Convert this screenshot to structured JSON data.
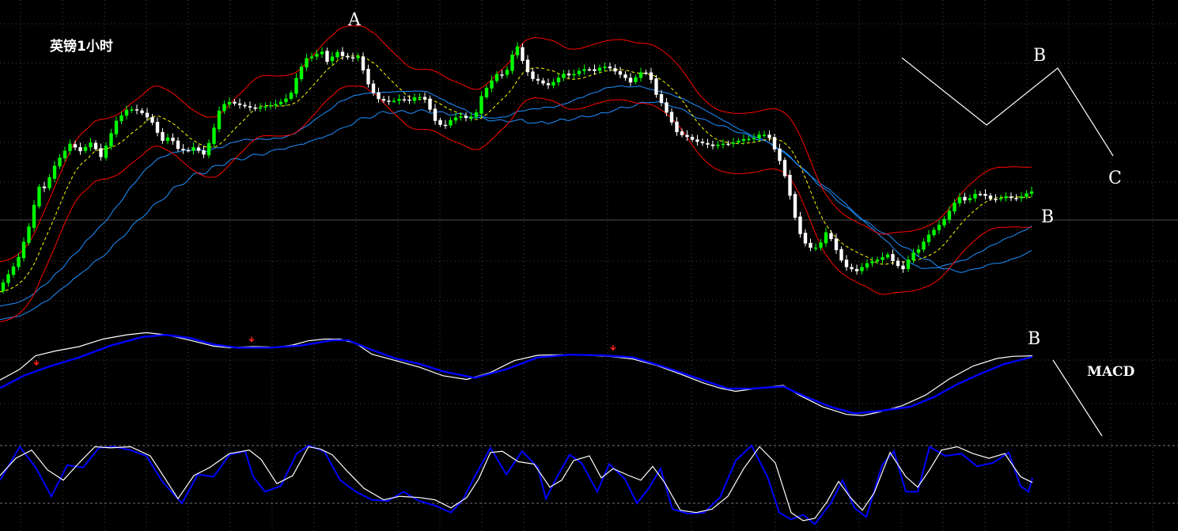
{
  "chart_data": {
    "type": "candlestick",
    "title": "英镑1小时",
    "indicator_label": "MACD",
    "wave_labels": {
      "price_top": "A",
      "diagram_b": "B",
      "diagram_c": "C",
      "price_right": "B",
      "macd_right": "B"
    },
    "colors": {
      "up": "#00ff00",
      "down": "#ffffff",
      "band": "#ff0000",
      "ma": "#1e90ff",
      "mid": "#ffff00",
      "macd_fast": "#ffffff",
      "macd_slow": "#0000ff",
      "kdj_fast": "#ffffff",
      "kdj_slow": "#0000ff",
      "marker": "#ff2020",
      "grid": "#5a5a5a"
    },
    "grid": true,
    "price_path": [
      [
        0,
        0.02
      ],
      [
        18,
        0.11
      ],
      [
        25,
        0.14
      ],
      [
        40,
        0.28
      ],
      [
        52,
        0.44
      ],
      [
        62,
        0.43
      ],
      [
        68,
        0.5
      ],
      [
        78,
        0.55
      ],
      [
        92,
        0.61
      ],
      [
        105,
        0.58
      ],
      [
        120,
        0.62
      ],
      [
        130,
        0.55
      ],
      [
        140,
        0.62
      ],
      [
        150,
        0.7
      ],
      [
        165,
        0.75
      ],
      [
        180,
        0.74
      ],
      [
        195,
        0.7
      ],
      [
        208,
        0.62
      ],
      [
        218,
        0.64
      ],
      [
        228,
        0.59
      ],
      [
        240,
        0.58
      ],
      [
        250,
        0.6
      ],
      [
        260,
        0.56
      ],
      [
        270,
        0.63
      ],
      [
        280,
        0.74
      ],
      [
        290,
        0.78
      ],
      [
        300,
        0.77
      ],
      [
        312,
        0.76
      ],
      [
        325,
        0.75
      ],
      [
        340,
        0.76
      ],
      [
        355,
        0.77
      ],
      [
        370,
        0.8
      ],
      [
        380,
        0.89
      ],
      [
        390,
        0.95
      ],
      [
        400,
        0.96
      ],
      [
        410,
        0.98
      ],
      [
        418,
        0.93
      ],
      [
        428,
        0.98
      ],
      [
        436,
        0.96
      ],
      [
        448,
        0.95
      ],
      [
        458,
        0.96
      ],
      [
        465,
        0.87
      ],
      [
        472,
        0.83
      ],
      [
        480,
        0.79
      ],
      [
        490,
        0.78
      ],
      [
        500,
        0.78
      ],
      [
        510,
        0.79
      ],
      [
        520,
        0.78
      ],
      [
        530,
        0.8
      ],
      [
        540,
        0.79
      ],
      [
        548,
        0.74
      ],
      [
        555,
        0.69
      ],
      [
        565,
        0.68
      ],
      [
        575,
        0.71
      ],
      [
        585,
        0.72
      ],
      [
        595,
        0.71
      ],
      [
        605,
        0.73
      ],
      [
        612,
        0.8
      ],
      [
        622,
        0.85
      ],
      [
        632,
        0.89
      ],
      [
        642,
        0.88
      ],
      [
        650,
        0.96
      ],
      [
        658,
        1.0
      ],
      [
        666,
        0.92
      ],
      [
        675,
        0.87
      ],
      [
        685,
        0.86
      ],
      [
        695,
        0.84
      ],
      [
        705,
        0.86
      ],
      [
        715,
        0.89
      ],
      [
        725,
        0.88
      ],
      [
        735,
        0.9
      ],
      [
        745,
        0.91
      ],
      [
        755,
        0.9
      ],
      [
        765,
        0.92
      ],
      [
        775,
        0.91
      ],
      [
        785,
        0.89
      ],
      [
        795,
        0.87
      ],
      [
        802,
        0.85
      ],
      [
        810,
        0.89
      ],
      [
        818,
        0.9
      ],
      [
        826,
        0.87
      ],
      [
        832,
        0.81
      ],
      [
        840,
        0.77
      ],
      [
        850,
        0.71
      ],
      [
        860,
        0.65
      ],
      [
        870,
        0.64
      ],
      [
        882,
        0.62
      ],
      [
        894,
        0.61
      ],
      [
        905,
        0.6
      ],
      [
        915,
        0.61
      ],
      [
        925,
        0.61
      ],
      [
        935,
        0.62
      ],
      [
        945,
        0.63
      ],
      [
        955,
        0.63
      ],
      [
        965,
        0.65
      ],
      [
        975,
        0.64
      ],
      [
        985,
        0.57
      ],
      [
        992,
        0.52
      ],
      [
        1000,
        0.43
      ],
      [
        1008,
        0.32
      ],
      [
        1016,
        0.24
      ],
      [
        1024,
        0.2
      ],
      [
        1032,
        0.19
      ],
      [
        1040,
        0.21
      ],
      [
        1048,
        0.26
      ],
      [
        1056,
        0.22
      ],
      [
        1064,
        0.16
      ],
      [
        1072,
        0.12
      ],
      [
        1080,
        0.11
      ],
      [
        1088,
        0.1
      ],
      [
        1096,
        0.13
      ],
      [
        1105,
        0.14
      ],
      [
        1115,
        0.15
      ],
      [
        1125,
        0.17
      ],
      [
        1135,
        0.13
      ],
      [
        1145,
        0.11
      ],
      [
        1155,
        0.17
      ],
      [
        1165,
        0.19
      ],
      [
        1175,
        0.24
      ],
      [
        1185,
        0.27
      ],
      [
        1195,
        0.3
      ],
      [
        1205,
        0.35
      ],
      [
        1215,
        0.4
      ],
      [
        1225,
        0.38
      ],
      [
        1235,
        0.41
      ],
      [
        1245,
        0.41
      ],
      [
        1255,
        0.39
      ],
      [
        1265,
        0.39
      ],
      [
        1275,
        0.4
      ],
      [
        1285,
        0.39
      ],
      [
        1295,
        0.4
      ],
      [
        1305,
        0.42
      ]
    ],
    "macd_white": [
      [
        0,
        0.1
      ],
      [
        25,
        0.3
      ],
      [
        45,
        0.55
      ],
      [
        70,
        0.64
      ],
      [
        100,
        0.72
      ],
      [
        130,
        0.86
      ],
      [
        160,
        0.94
      ],
      [
        185,
        0.98
      ],
      [
        210,
        0.94
      ],
      [
        240,
        0.84
      ],
      [
        270,
        0.73
      ],
      [
        290,
        0.7
      ],
      [
        320,
        0.72
      ],
      [
        350,
        0.71
      ],
      [
        370,
        0.75
      ],
      [
        390,
        0.83
      ],
      [
        410,
        0.86
      ],
      [
        430,
        0.86
      ],
      [
        450,
        0.78
      ],
      [
        470,
        0.58
      ],
      [
        500,
        0.46
      ],
      [
        530,
        0.34
      ],
      [
        560,
        0.18
      ],
      [
        590,
        0.11
      ],
      [
        620,
        0.24
      ],
      [
        650,
        0.46
      ],
      [
        680,
        0.56
      ],
      [
        710,
        0.57
      ],
      [
        740,
        0.56
      ],
      [
        770,
        0.54
      ],
      [
        800,
        0.49
      ],
      [
        830,
        0.37
      ],
      [
        860,
        0.21
      ],
      [
        890,
        0.04
      ],
      [
        910,
        -0.05
      ],
      [
        930,
        -0.11
      ],
      [
        960,
        -0.05
      ],
      [
        990,
        0.0
      ],
      [
        1010,
        -0.18
      ],
      [
        1040,
        -0.4
      ],
      [
        1070,
        -0.54
      ],
      [
        1090,
        -0.56
      ],
      [
        1110,
        -0.5
      ],
      [
        1140,
        -0.38
      ],
      [
        1170,
        -0.18
      ],
      [
        1200,
        0.12
      ],
      [
        1230,
        0.36
      ],
      [
        1260,
        0.5
      ],
      [
        1280,
        0.54
      ],
      [
        1305,
        0.55
      ]
    ],
    "macd_blue": [
      [
        0,
        -0.05
      ],
      [
        30,
        0.18
      ],
      [
        60,
        0.34
      ],
      [
        100,
        0.52
      ],
      [
        140,
        0.74
      ],
      [
        180,
        0.9
      ],
      [
        210,
        0.94
      ],
      [
        240,
        0.88
      ],
      [
        270,
        0.76
      ],
      [
        300,
        0.7
      ],
      [
        340,
        0.7
      ],
      [
        380,
        0.74
      ],
      [
        420,
        0.84
      ],
      [
        440,
        0.84
      ],
      [
        470,
        0.66
      ],
      [
        500,
        0.5
      ],
      [
        530,
        0.4
      ],
      [
        560,
        0.26
      ],
      [
        600,
        0.14
      ],
      [
        640,
        0.3
      ],
      [
        680,
        0.52
      ],
      [
        720,
        0.57
      ],
      [
        760,
        0.56
      ],
      [
        800,
        0.52
      ],
      [
        840,
        0.34
      ],
      [
        880,
        0.14
      ],
      [
        920,
        -0.06
      ],
      [
        950,
        -0.06
      ],
      [
        990,
        -0.02
      ],
      [
        1020,
        -0.22
      ],
      [
        1050,
        -0.4
      ],
      [
        1080,
        -0.52
      ],
      [
        1110,
        -0.48
      ],
      [
        1150,
        -0.4
      ],
      [
        1180,
        -0.22
      ],
      [
        1210,
        0.02
      ],
      [
        1240,
        0.22
      ],
      [
        1270,
        0.4
      ],
      [
        1305,
        0.53
      ]
    ],
    "kdj_fast": [
      [
        0,
        0.48
      ],
      [
        20,
        0.78
      ],
      [
        40,
        0.92
      ],
      [
        60,
        0.58
      ],
      [
        80,
        0.4
      ],
      [
        100,
        0.7
      ],
      [
        120,
        0.98
      ],
      [
        140,
        0.96
      ],
      [
        165,
        0.98
      ],
      [
        190,
        0.82
      ],
      [
        210,
        0.4
      ],
      [
        225,
        0.08
      ],
      [
        245,
        0.48
      ],
      [
        265,
        0.62
      ],
      [
        290,
        0.86
      ],
      [
        315,
        0.92
      ],
      [
        330,
        0.76
      ],
      [
        350,
        0.34
      ],
      [
        370,
        0.48
      ],
      [
        390,
        0.98
      ],
      [
        405,
        0.94
      ],
      [
        420,
        0.84
      ],
      [
        440,
        0.54
      ],
      [
        460,
        0.26
      ],
      [
        485,
        0.06
      ],
      [
        505,
        0.12
      ],
      [
        530,
        0.1
      ],
      [
        550,
        0.06
      ],
      [
        570,
        -0.08
      ],
      [
        590,
        0.1
      ],
      [
        605,
        0.42
      ],
      [
        620,
        0.88
      ],
      [
        635,
        0.9
      ],
      [
        655,
        0.72
      ],
      [
        675,
        0.68
      ],
      [
        695,
        0.28
      ],
      [
        710,
        0.4
      ],
      [
        725,
        0.74
      ],
      [
        745,
        0.82
      ],
      [
        760,
        0.44
      ],
      [
        775,
        0.6
      ],
      [
        795,
        0.48
      ],
      [
        810,
        0.4
      ],
      [
        825,
        0.64
      ],
      [
        840,
        0.36
      ],
      [
        860,
        -0.12
      ],
      [
        880,
        -0.16
      ],
      [
        900,
        -0.1
      ],
      [
        920,
        0.12
      ],
      [
        940,
        0.6
      ],
      [
        960,
        0.98
      ],
      [
        980,
        0.7
      ],
      [
        1000,
        -0.16
      ],
      [
        1015,
        -0.3
      ],
      [
        1030,
        -0.26
      ],
      [
        1045,
        0.02
      ],
      [
        1060,
        0.38
      ],
      [
        1075,
        0.1
      ],
      [
        1090,
        -0.12
      ],
      [
        1105,
        0.18
      ],
      [
        1125,
        0.88
      ],
      [
        1145,
        0.46
      ],
      [
        1160,
        0.28
      ],
      [
        1175,
        0.58
      ],
      [
        1190,
        0.92
      ],
      [
        1210,
        0.98
      ],
      [
        1230,
        0.86
      ],
      [
        1250,
        0.78
      ],
      [
        1270,
        0.86
      ],
      [
        1290,
        0.46
      ],
      [
        1305,
        0.36
      ]
    ],
    "kdj_slow": [
      [
        0,
        0.4
      ],
      [
        25,
        0.98
      ],
      [
        45,
        0.62
      ],
      [
        65,
        0.12
      ],
      [
        85,
        0.66
      ],
      [
        105,
        0.62
      ],
      [
        125,
        0.96
      ],
      [
        145,
        0.98
      ],
      [
        165,
        0.92
      ],
      [
        185,
        0.82
      ],
      [
        205,
        0.38
      ],
      [
        230,
        0.0
      ],
      [
        250,
        0.5
      ],
      [
        270,
        0.46
      ],
      [
        290,
        0.84
      ],
      [
        310,
        0.9
      ],
      [
        320,
        0.46
      ],
      [
        335,
        0.2
      ],
      [
        355,
        0.3
      ],
      [
        375,
        0.86
      ],
      [
        390,
        1.0
      ],
      [
        410,
        0.9
      ],
      [
        430,
        0.4
      ],
      [
        450,
        0.2
      ],
      [
        470,
        0.06
      ],
      [
        490,
        0.04
      ],
      [
        510,
        0.2
      ],
      [
        530,
        0.04
      ],
      [
        550,
        -0.04
      ],
      [
        570,
        -0.16
      ],
      [
        585,
        0.06
      ],
      [
        600,
        0.46
      ],
      [
        620,
        0.96
      ],
      [
        640,
        0.5
      ],
      [
        660,
        0.9
      ],
      [
        680,
        0.62
      ],
      [
        690,
        0.08
      ],
      [
        705,
        0.48
      ],
      [
        720,
        0.84
      ],
      [
        735,
        0.7
      ],
      [
        755,
        0.2
      ],
      [
        770,
        0.68
      ],
      [
        790,
        0.42
      ],
      [
        805,
        0.0
      ],
      [
        820,
        0.26
      ],
      [
        835,
        0.6
      ],
      [
        850,
        -0.1
      ],
      [
        870,
        -0.18
      ],
      [
        890,
        -0.16
      ],
      [
        910,
        0.1
      ],
      [
        930,
        0.74
      ],
      [
        950,
        1.0
      ],
      [
        970,
        0.46
      ],
      [
        985,
        -0.16
      ],
      [
        1000,
        -0.28
      ],
      [
        1015,
        -0.2
      ],
      [
        1030,
        -0.36
      ],
      [
        1050,
        0.0
      ],
      [
        1065,
        0.4
      ],
      [
        1080,
        -0.08
      ],
      [
        1095,
        -0.24
      ],
      [
        1115,
        0.66
      ],
      [
        1130,
        0.9
      ],
      [
        1145,
        0.2
      ],
      [
        1160,
        0.2
      ],
      [
        1175,
        0.98
      ],
      [
        1195,
        0.82
      ],
      [
        1215,
        0.86
      ],
      [
        1235,
        0.64
      ],
      [
        1255,
        0.7
      ],
      [
        1275,
        0.88
      ],
      [
        1290,
        0.3
      ],
      [
        1300,
        0.2
      ],
      [
        1305,
        0.44
      ]
    ],
    "macd_markers_x": [
      46,
      318,
      775
    ]
  }
}
